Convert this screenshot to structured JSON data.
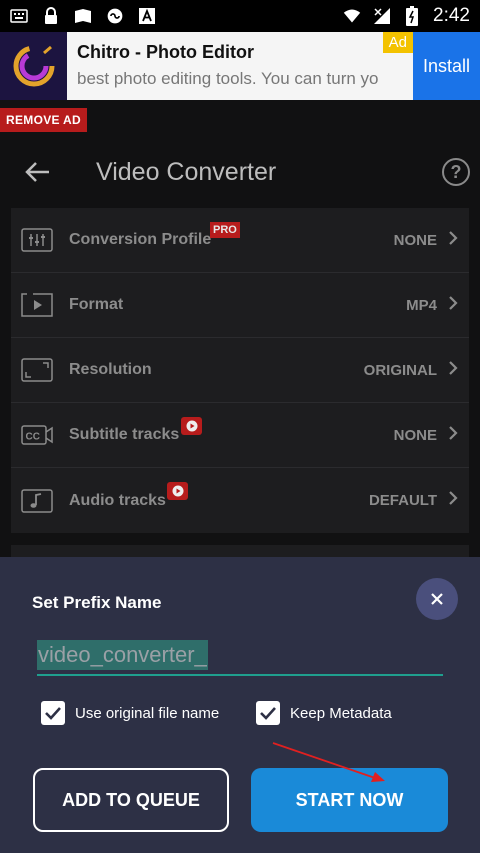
{
  "status_bar": {
    "time": "2:42",
    "left_icons": [
      "keyboard-icon",
      "lock-icon",
      "photo-icon",
      "cloud-link-icon",
      "font-icon"
    ],
    "right_icons": [
      "wifi-icon",
      "signal-icon",
      "battery-icon"
    ]
  },
  "ad": {
    "title": "Chitro - Photo Editor",
    "description": "best photo editing tools. You can turn yo",
    "badge": "Ad",
    "install_label": "Install",
    "remove_ad_label": "REMOVE AD"
  },
  "appbar": {
    "title": "Video Converter",
    "help_label": "?"
  },
  "settings": [
    {
      "icon": "sliders-icon",
      "label": "Conversion Profile",
      "value": "NONE",
      "badge": "PRO"
    },
    {
      "icon": "play-frame-icon",
      "label": "Format",
      "value": "MP4"
    },
    {
      "icon": "resolution-icon",
      "label": "Resolution",
      "value": "ORIGINAL"
    },
    {
      "icon": "cc-icon",
      "label": "Subtitle tracks",
      "value": "NONE",
      "badge_icon": "video-play-badge-icon"
    },
    {
      "icon": "music-note-icon",
      "label": "Audio tracks",
      "value": "DEFAULT",
      "badge_icon": "video-play-badge-icon"
    }
  ],
  "sheet": {
    "title": "Set Prefix Name",
    "prefix_value": "video_converter_",
    "checkbox_original": {
      "label": "Use original file name",
      "checked": true
    },
    "checkbox_metadata": {
      "label": "Keep Metadata",
      "checked": true
    },
    "add_to_queue_label": "ADD TO QUEUE",
    "start_now_label": "START NOW"
  },
  "colors": {
    "accent_teal": "#1f9f8e",
    "start_button": "#1a8ad8",
    "sheet_bg": "#2d3045",
    "badge_red": "#b71c1c",
    "annotation_arrow": "#e02020"
  }
}
